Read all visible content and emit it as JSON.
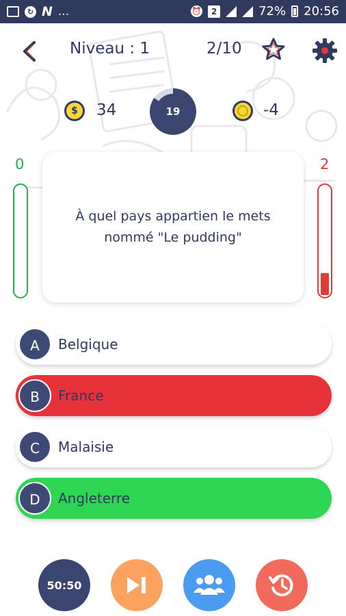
{
  "status_bar": {
    "dots": "...",
    "badge": "2",
    "battery": "72%",
    "time": "20:56"
  },
  "header": {
    "level": "Niveau : 1",
    "progress": "2/10"
  },
  "stats": {
    "money": "34",
    "timer": "19",
    "timer_fraction": 0.85,
    "score": "-4",
    "dollar_symbol": "$"
  },
  "gauges": {
    "correct": "0",
    "wrong": "2",
    "wrong_fraction": 0.2
  },
  "question": {
    "text": "À quel pays appartien le mets nommé \"Le pudding\""
  },
  "answers": [
    {
      "letter": "A",
      "label": "Belgique",
      "state": "neutral"
    },
    {
      "letter": "B",
      "label": "France",
      "state": "wrong"
    },
    {
      "letter": "C",
      "label": "Malaisie",
      "state": "neutral"
    },
    {
      "letter": "D",
      "label": "Angleterre",
      "state": "correct"
    }
  ],
  "jokers": {
    "fifty_fifty": "50:50"
  },
  "colors": {
    "navy": "#2f3a5e",
    "wrong": "#e8323a",
    "correct": "#2ed653",
    "skip": "#f9a35f",
    "people": "#4b9bf0",
    "history": "#f26a5b"
  },
  "icons": [
    "back-icon",
    "star-icon",
    "gear-icon",
    "dollar-coin-icon",
    "gold-coin-icon",
    "skip-icon",
    "people-icon",
    "history-icon"
  ]
}
